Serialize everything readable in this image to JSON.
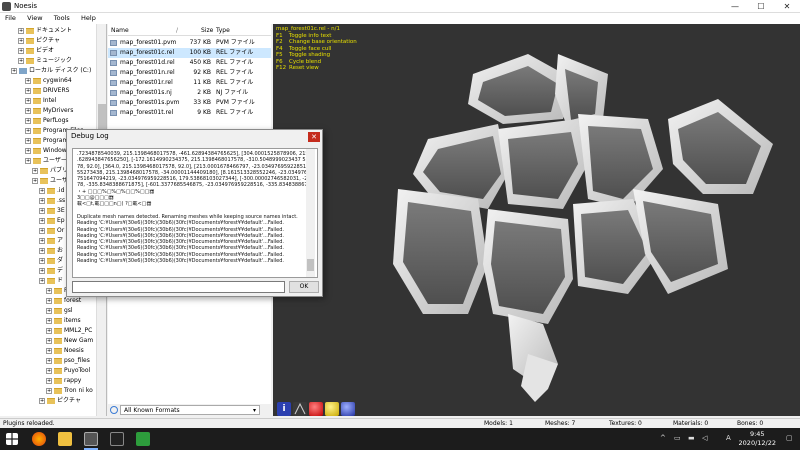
{
  "window": {
    "title": "Noesis",
    "minimize": "—",
    "maximize": "☐",
    "close": "✕"
  },
  "menu": [
    "File",
    "View",
    "Tools",
    "Help"
  ],
  "tree": {
    "items": [
      {
        "label": "ドキュメント",
        "depth": 2
      },
      {
        "label": "ピクチャ",
        "depth": 2
      },
      {
        "label": "ビデオ",
        "depth": 2
      },
      {
        "label": "ミュージック",
        "depth": 2
      },
      {
        "label": "ローカル ディスク (C:)",
        "depth": 1
      },
      {
        "label": "cygwin64",
        "depth": 3
      },
      {
        "label": "DRIVERS",
        "depth": 3
      },
      {
        "label": "Intel",
        "depth": 3
      },
      {
        "label": "MyDrivers",
        "depth": 3
      },
      {
        "label": "PerfLogs",
        "depth": 3
      },
      {
        "label": "Program Files",
        "depth": 3
      },
      {
        "label": "Program",
        "depth": 3
      },
      {
        "label": "Windows",
        "depth": 3
      },
      {
        "label": "ユーザー",
        "depth": 3
      },
      {
        "label": "パブリ",
        "depth": 4
      },
      {
        "label": "ユーザ",
        "depth": 4
      },
      {
        "label": ".id",
        "depth": 5
      },
      {
        "label": ".ss",
        "depth": 5
      },
      {
        "label": "3E",
        "depth": 5
      },
      {
        "label": "Ep",
        "depth": 5
      },
      {
        "label": "Or",
        "depth": 5
      },
      {
        "label": "ア",
        "depth": 5
      },
      {
        "label": "お",
        "depth": 5
      },
      {
        "label": "ダ",
        "depth": 5
      },
      {
        "label": "デ",
        "depth": 5
      },
      {
        "label": "ド",
        "depth": 5
      },
      {
        "label": "F7-Multi-",
        "depth": 6
      },
      {
        "label": "forest",
        "depth": 6
      },
      {
        "label": "gsl",
        "depth": 6
      },
      {
        "label": "items",
        "depth": 6
      },
      {
        "label": "MML2_PC",
        "depth": 6
      },
      {
        "label": "New Gam",
        "depth": 6
      },
      {
        "label": "Noesis",
        "depth": 6
      },
      {
        "label": "pso_files",
        "depth": 6
      },
      {
        "label": "PuyoTool",
        "depth": 6
      },
      {
        "label": "rappy",
        "depth": 6
      },
      {
        "label": "Tron ni ko",
        "depth": 6
      },
      {
        "label": "ピクチャ",
        "depth": 5
      }
    ]
  },
  "filelist": {
    "headers": {
      "name": "Name",
      "size": "Size",
      "type": "Type"
    },
    "rows": [
      {
        "name": "map_forest01.pvm",
        "size": "737 KB",
        "type": "PVM ファイル",
        "selected": false
      },
      {
        "name": "map_forest01c.rel",
        "size": "100 KB",
        "type": "REL ファイル",
        "selected": true
      },
      {
        "name": "map_forest01d.rel",
        "size": "450 KB",
        "type": "REL ファイル",
        "selected": false
      },
      {
        "name": "map_forest01n.rel",
        "size": "92 KB",
        "type": "REL ファイル",
        "selected": false
      },
      {
        "name": "map_forest01r.rel",
        "size": "11 KB",
        "type": "REL ファイル",
        "selected": false
      },
      {
        "name": "map_forest01s.nj",
        "size": "2 KB",
        "type": "NJ ファイル",
        "selected": false
      },
      {
        "name": "map_forest01s.pvm",
        "size": "33 KB",
        "type": "PVM ファイル",
        "selected": false
      },
      {
        "name": "map_forest01t.rel",
        "size": "9 KB",
        "type": "REL ファイル",
        "selected": false
      }
    ],
    "filter": "All Known Formats"
  },
  "hud": {
    "title": "map_forest01c.rel - n/1",
    "items": [
      {
        "key": "F1",
        "desc": "Toggle info text"
      },
      {
        "key": "F2",
        "desc": "Change base orientation"
      },
      {
        "key": "F4",
        "desc": "Toggle face cull"
      },
      {
        "key": "F5",
        "desc": "Toggle shading"
      },
      {
        "key": "F6",
        "desc": "Cycle blend"
      },
      {
        "key": "F12",
        "desc": "Reset view"
      }
    ]
  },
  "debug": {
    "title": "Debug Log",
    "close": "✕",
    "lines": [
      ".7234878540039, 215.1398468017578, -461.62894384765625], [304.0001525878906, 215.13984",
      ".628943847656250], [-172.1614990234375, 215.1398468017578, -310.5048999023437 5], [-99.72",
      "78, 92.0], [364.0, 215.1398468017578, 92.0], [213.0001678466797, -23.034976959228516, 92.0",
      "55273438, 215.1398468017578, -34.00001144409180], [8.161513328552246, -23.034976959228 5",
      "751647094219, -23.034976959228516, 179.53868103027344], [-300.00002746582031, -23.03497",
      "78, -335.8348388671875], [-601.3377685546875, -23.034976959228516, -335.8348388671875],",
      "・+ □□□%□%□%□□%□□器",
      "3□□@□□□器",
      "載<□t,載□□□n□( ?□載<□器",
      "",
      "Duplicate mesh names detected. Renaming meshes while keeping source names intact.",
      "Reading 'C:¥Users¥(30e6)(30fc)(30b6)(30fc)¥Documents¥forest¥¥default'...Failed.",
      "Reading 'C:¥Users¥(30e6)(30fc)(30b6)(30fc)¥Documents¥forest¥¥default'...Failed.",
      "Reading 'C:¥Users¥(30e6)(30fc)(30b6)(30fc)¥Documents¥forest¥¥default'...Failed.",
      "Reading 'C:¥Users¥(30e6)(30fc)(30b6)(30fc)¥Documents¥forest¥¥default'...Failed.",
      "Reading 'C:¥Users¥(30e6)(30fc)(30b6)(30fc)¥Documents¥forest¥¥default'...Failed.",
      "Reading 'C:¥Users¥(30e6)(30fc)(30b6)(30fc)¥Documents¥forest¥¥default'...Failed.",
      "Reading 'C:¥Users¥(30e6)(30fc)(30b6)(30fc)¥Documents¥forest¥¥default'...Failed."
    ],
    "input_value": "",
    "ok_label": "OK"
  },
  "status": {
    "message": "Plugins reloaded.",
    "models": "Models: 1",
    "meshes": "Meshes: 7",
    "textures": "Textures: 0",
    "materials": "Materials: 0",
    "bones": "Bones: 0"
  },
  "taskbar": {
    "time": "9:45",
    "date": "2020/12/22",
    "ime": "A"
  },
  "colors": {
    "viewport_bg": "#333333",
    "hud_text": "#e8e000",
    "close_red": "#c42b1c",
    "selection": "#cde8ff"
  }
}
